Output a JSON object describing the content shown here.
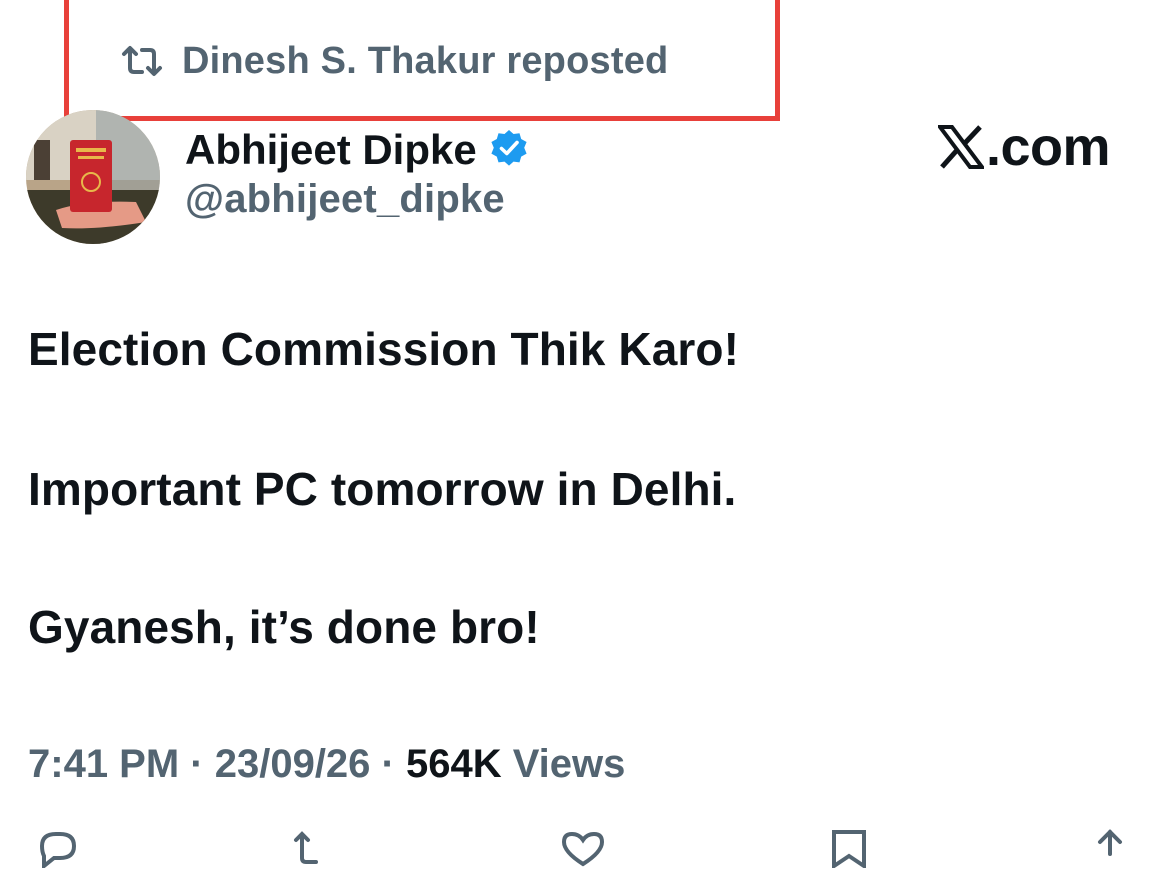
{
  "repost": {
    "icon": "repost-icon",
    "label": "Dinesh S. Thakur reposted"
  },
  "author": {
    "name": "Abhijeet Dipke",
    "verified_icon": "verified-badge-icon",
    "handle": "@abhijeet_dipke",
    "avatar": "avatar"
  },
  "brand": {
    "icon": "x-logo-icon",
    "label": ".com"
  },
  "tweet": {
    "lines": [
      "Election Commission Thik Karo!",
      "Important PC tomorrow in Delhi.",
      "Gyanesh, it’s done bro!"
    ]
  },
  "meta": {
    "time": "7:41 PM",
    "sep1": " · ",
    "date": "23/09/26",
    "sep2": " · ",
    "views_count": "564K",
    "views_label": " Views"
  },
  "actions": [
    {
      "icon": "reply-icon"
    },
    {
      "icon": "retweet-icon"
    },
    {
      "icon": "like-icon"
    },
    {
      "icon": "bookmark-icon"
    },
    {
      "icon": "share-icon"
    }
  ],
  "colors": {
    "highlight": "#e8403a",
    "muted": "#536471",
    "text": "#0f1419",
    "verified": "#1d9bf0"
  }
}
